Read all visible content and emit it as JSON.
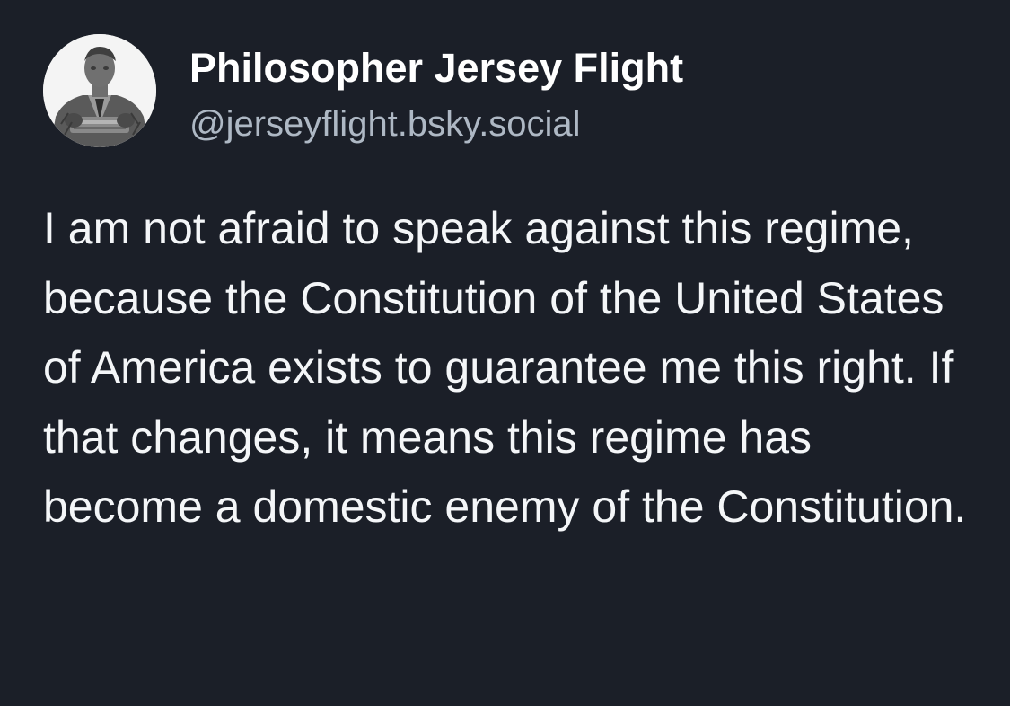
{
  "post": {
    "author": {
      "display_name": "Philosopher Jersey Flight",
      "handle": "@jerseyflight.bsky.social",
      "avatar_icon": "statue-portrait"
    },
    "text": "I am not afraid to speak against this regime, because the Constitution of the United States of America exists to guarantee me this right. If that changes, it means this regime has become a domestic enemy of the Constitution."
  },
  "colors": {
    "background": "#1b1f28",
    "name": "#ffffff",
    "handle": "#aeb8c4",
    "text": "#f4f6f8"
  }
}
